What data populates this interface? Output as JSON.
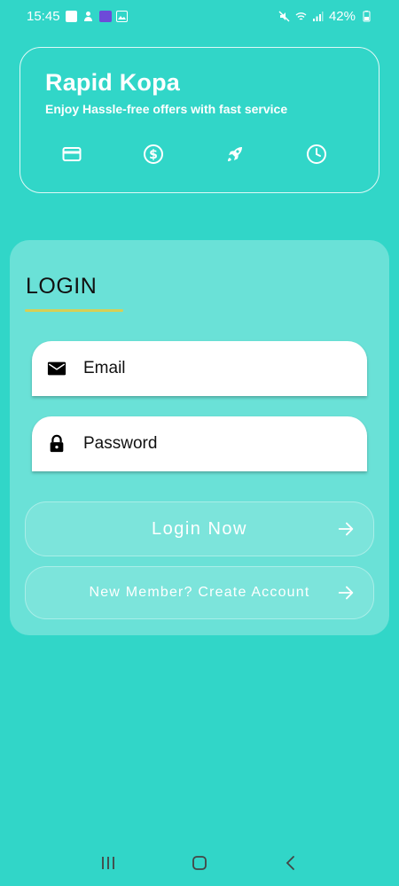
{
  "status_bar": {
    "time": "15:45",
    "battery": "42%"
  },
  "header": {
    "title": "Rapid Kopa",
    "subtitle": "Enjoy Hassle-free offers with fast service",
    "feature_icons": [
      "card-icon",
      "dollar-icon",
      "rocket-icon",
      "clock-icon"
    ]
  },
  "login": {
    "title": "LOGIN",
    "email_placeholder": "Email",
    "password_placeholder": "Password",
    "login_button": "Login Now",
    "create_button": "New Member? Create Account"
  },
  "colors": {
    "background": "#31d6c8",
    "underline": "#d7cf55"
  }
}
